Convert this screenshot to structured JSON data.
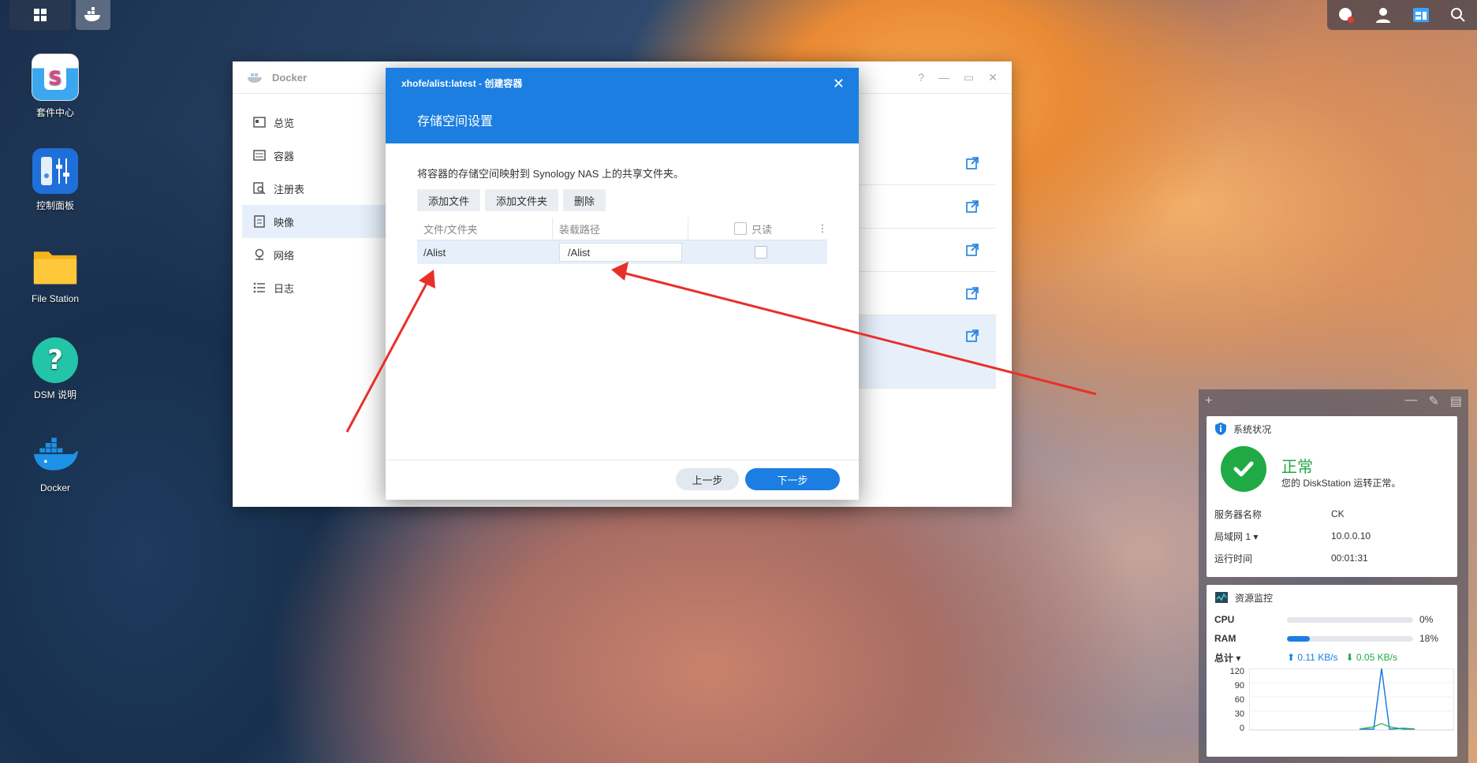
{
  "taskbar": {
    "apps": [
      "main-menu",
      "docker"
    ]
  },
  "desktop": {
    "icons": [
      {
        "label": "套件中心",
        "icon": "package-center-icon"
      },
      {
        "label": "控制面板",
        "icon": "control-panel-icon"
      },
      {
        "label": "File Station",
        "icon": "folder-icon"
      },
      {
        "label": "DSM 说明",
        "icon": "help-icon"
      },
      {
        "label": "Docker",
        "icon": "docker-icon"
      }
    ]
  },
  "docker_window": {
    "title": "Docker",
    "sidebar": [
      {
        "label": "总览",
        "icon": "overview-icon"
      },
      {
        "label": "容器",
        "icon": "container-icon"
      },
      {
        "label": "注册表",
        "icon": "registry-icon"
      },
      {
        "label": "映像",
        "icon": "image-icon",
        "active": true
      },
      {
        "label": "网络",
        "icon": "network-icon"
      },
      {
        "label": "日志",
        "icon": "log-icon"
      }
    ]
  },
  "dialog": {
    "window_title": "xhofe/alist:latest - 创建容器",
    "heading": "存储空间设置",
    "description": "将容器的存储空间映射到 Synology NAS 上的共享文件夹。",
    "toolbar": {
      "add_file": "添加文件",
      "add_folder": "添加文件夹",
      "delete": "删除"
    },
    "table": {
      "headers": {
        "file_folder": "文件/文件夹",
        "mount_path": "装载路径",
        "readonly": "只读"
      },
      "rows": [
        {
          "file_folder": "/Alist",
          "mount_path": "/Alist",
          "readonly": false
        }
      ]
    },
    "footer": {
      "prev": "上一步",
      "next": "下一步"
    }
  },
  "widgets": {
    "system_status": {
      "title": "系统状况",
      "status": "正常",
      "message": "您的 DiskStation 运转正常。",
      "rows": [
        {
          "label": "服务器名称",
          "value": "CK"
        },
        {
          "label": "局域网 1 ▾",
          "value": "10.0.0.10"
        },
        {
          "label": "运行时间",
          "value": "00:01:31"
        }
      ]
    },
    "resource_monitor": {
      "title": "资源监控",
      "cpu": {
        "label": "CPU",
        "value": "0%",
        "percent": 0
      },
      "ram": {
        "label": "RAM",
        "value": "18%",
        "percent": 18
      },
      "network": {
        "label": "总计 ▾",
        "upload": "0.11 KB/s",
        "download": "0.05 KB/s"
      },
      "chart_yticks": [
        "120",
        "90",
        "60",
        "30",
        "0"
      ]
    }
  },
  "colors": {
    "accent": "#1b7ee0",
    "ok": "#1faa45",
    "annotation_arrow": "#e8302a"
  }
}
